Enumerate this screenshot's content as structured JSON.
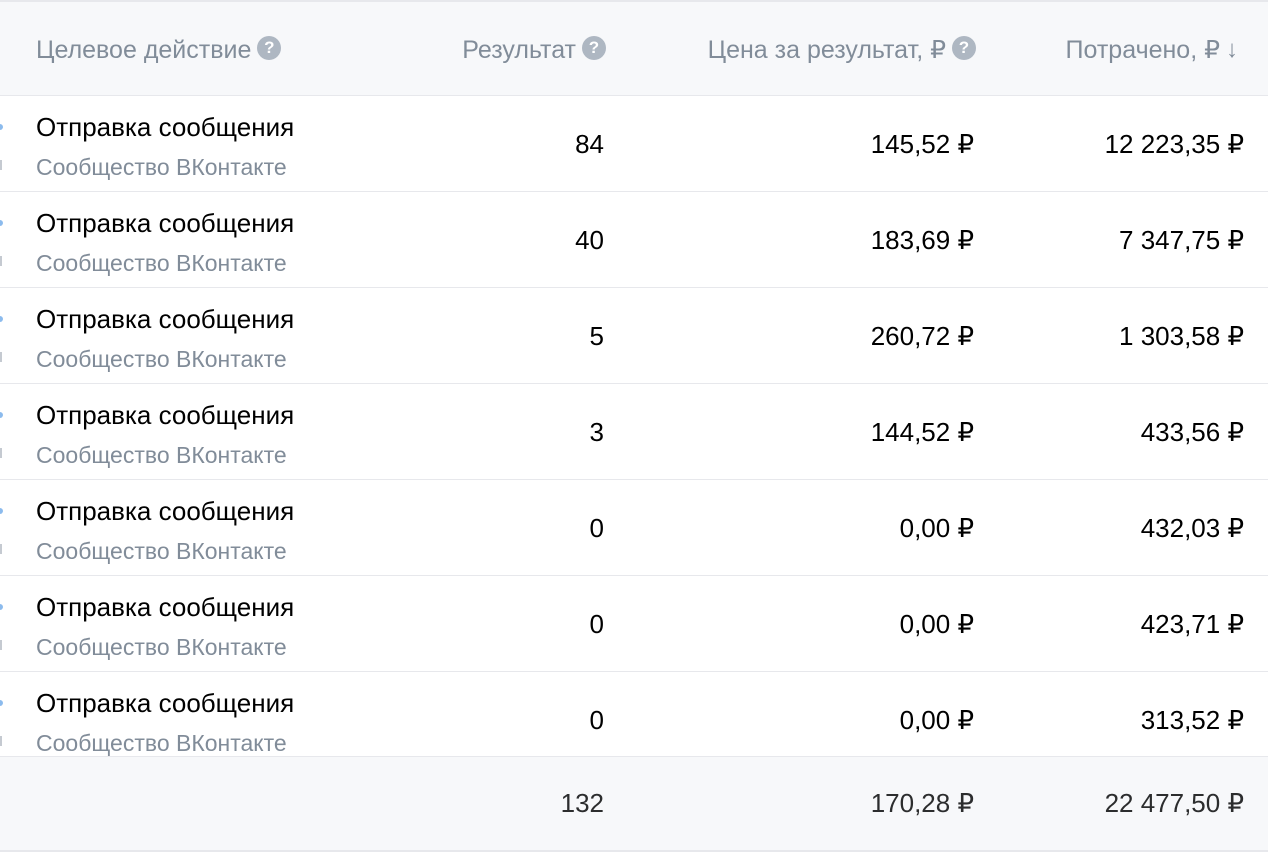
{
  "header": {
    "action": "Целевое действие",
    "result": "Результат",
    "price": "Цена за результат, ₽",
    "spent": "Потрачено, ₽"
  },
  "rows": [
    {
      "title": "Отправка сообщения",
      "subtitle": "Сообщество ВКонтакте",
      "result": "84",
      "price": "145,52 ₽",
      "spent": "12 223,35 ₽"
    },
    {
      "title": "Отправка сообщения",
      "subtitle": "Сообщество ВКонтакте",
      "result": "40",
      "price": "183,69 ₽",
      "spent": "7 347,75 ₽"
    },
    {
      "title": "Отправка сообщения",
      "subtitle": "Сообщество ВКонтакте",
      "result": "5",
      "price": "260,72 ₽",
      "spent": "1 303,58 ₽"
    },
    {
      "title": "Отправка сообщения",
      "subtitle": "Сообщество ВКонтакте",
      "result": "3",
      "price": "144,52 ₽",
      "spent": "433,56 ₽"
    },
    {
      "title": "Отправка сообщения",
      "subtitle": "Сообщество ВКонтакте",
      "result": "0",
      "price": "0,00 ₽",
      "spent": "432,03 ₽"
    },
    {
      "title": "Отправка сообщения",
      "subtitle": "Сообщество ВКонтакте",
      "result": "0",
      "price": "0,00 ₽",
      "spent": "423,71 ₽"
    },
    {
      "title": "Отправка сообщения",
      "subtitle": "Сообщество ВКонтакте",
      "result": "0",
      "price": "0,00 ₽",
      "spent": "313,52 ₽"
    }
  ],
  "totals": {
    "result": "132",
    "price": "170,28 ₽",
    "spent": "22 477,50 ₽"
  },
  "icons": {
    "help": "?",
    "sort": "↓"
  },
  "colors": {
    "header_bg": "#f7f8fa",
    "muted_text": "#818c99",
    "help_icon": "#aeb7c2",
    "divider": "#e7e8ec"
  }
}
